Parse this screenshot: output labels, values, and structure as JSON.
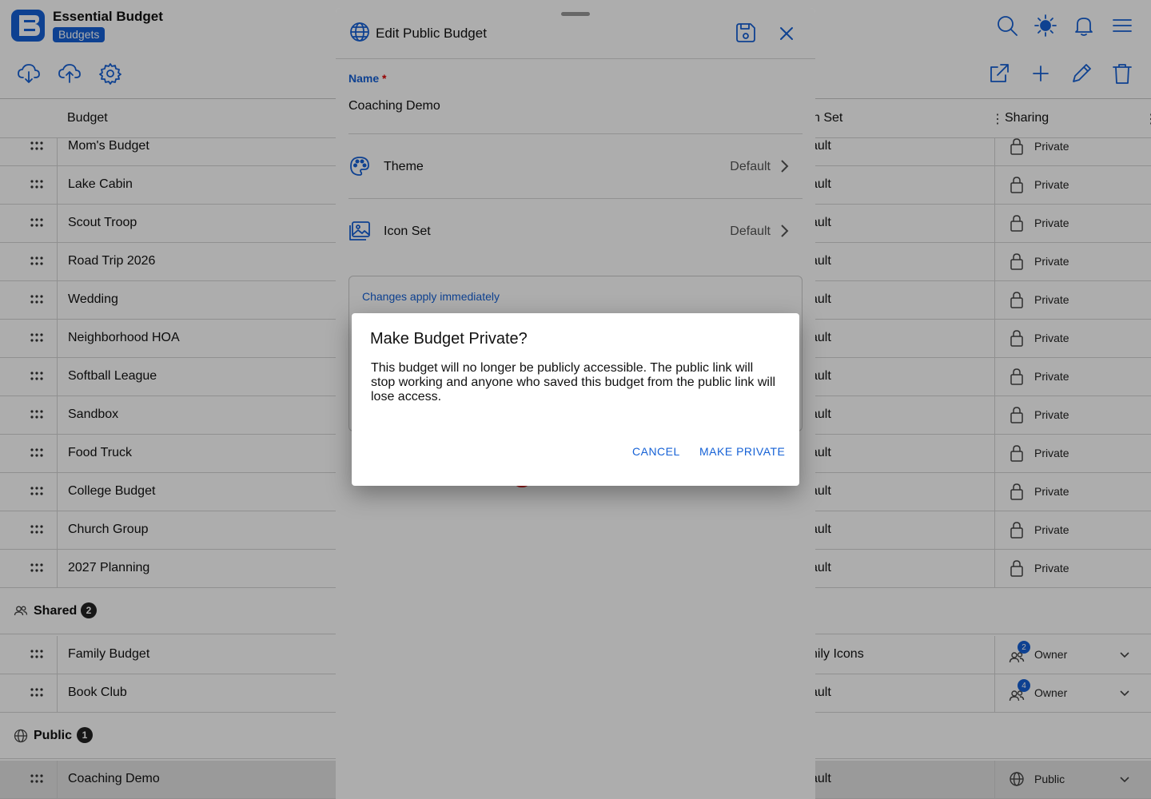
{
  "app": {
    "name": "Essential Budget",
    "section": "Budgets"
  },
  "colors": {
    "accent": "#1561d6",
    "destructive": "#dd0000",
    "dim_overlay": "rgba(0,0,0,0.32)"
  },
  "header_icons": {
    "left": [
      "cloud-download-icon",
      "cloud-upload-icon",
      "gear-icon"
    ],
    "top_right": [
      "search-icon",
      "sun-icon",
      "bell-icon",
      "menu-icon"
    ],
    "actions": [
      "external-link-icon",
      "plus-icon",
      "pencil-icon",
      "trash-icon"
    ]
  },
  "table": {
    "columns": {
      "budget": "Budget",
      "icon_set": "n Set",
      "sharing": "Sharing"
    },
    "private_rows": [
      {
        "name": "Mom's Budget",
        "icon_set": "ault",
        "sharing": "Private"
      },
      {
        "name": "Lake Cabin",
        "icon_set": "ault",
        "sharing": "Private"
      },
      {
        "name": "Scout Troop",
        "icon_set": "ault",
        "sharing": "Private"
      },
      {
        "name": "Road Trip 2026",
        "icon_set": "ault",
        "sharing": "Private"
      },
      {
        "name": "Wedding",
        "icon_set": "ault",
        "sharing": "Private"
      },
      {
        "name": "Neighborhood HOA",
        "icon_set": "ault",
        "sharing": "Private"
      },
      {
        "name": "Softball League",
        "icon_set": "ault",
        "sharing": "Private"
      },
      {
        "name": "Sandbox",
        "icon_set": "ault",
        "sharing": "Private"
      },
      {
        "name": "Food Truck",
        "icon_set": "ault",
        "sharing": "Private"
      },
      {
        "name": "College Budget",
        "icon_set": "ault",
        "sharing": "Private"
      },
      {
        "name": "Church Group",
        "icon_set": "ault",
        "sharing": "Private"
      },
      {
        "name": "2027 Planning",
        "icon_set": "ault",
        "sharing": "Private"
      }
    ],
    "shared_group": {
      "label": "Shared",
      "count": "2"
    },
    "shared_rows": [
      {
        "name": "Family Budget",
        "icon_set": "nily Icons",
        "sharing": "Owner",
        "members": "2"
      },
      {
        "name": "Book Club",
        "icon_set": "ault",
        "sharing": "Owner",
        "members": "4"
      }
    ],
    "public_group": {
      "label": "Public",
      "count": "1"
    },
    "public_rows": [
      {
        "name": "Coaching Demo",
        "icon_set": "ault",
        "sharing": "Public"
      }
    ]
  },
  "sheet": {
    "title": "Edit Public Budget",
    "name_label": "Name",
    "required_mark": "*",
    "name_value": "Coaching Demo",
    "theme": {
      "label": "Theme",
      "value": "Default"
    },
    "icon_set": {
      "label": "Icon Set",
      "value": "Default"
    },
    "notice": "Changes apply immediately"
  },
  "dialog": {
    "title": "Make Budget Private?",
    "body": "This budget will no longer be publicly accessible. The public link will stop working and anyone who saved this budget from the public link will lose access.",
    "cancel": "CANCEL",
    "confirm": "MAKE PRIVATE"
  }
}
